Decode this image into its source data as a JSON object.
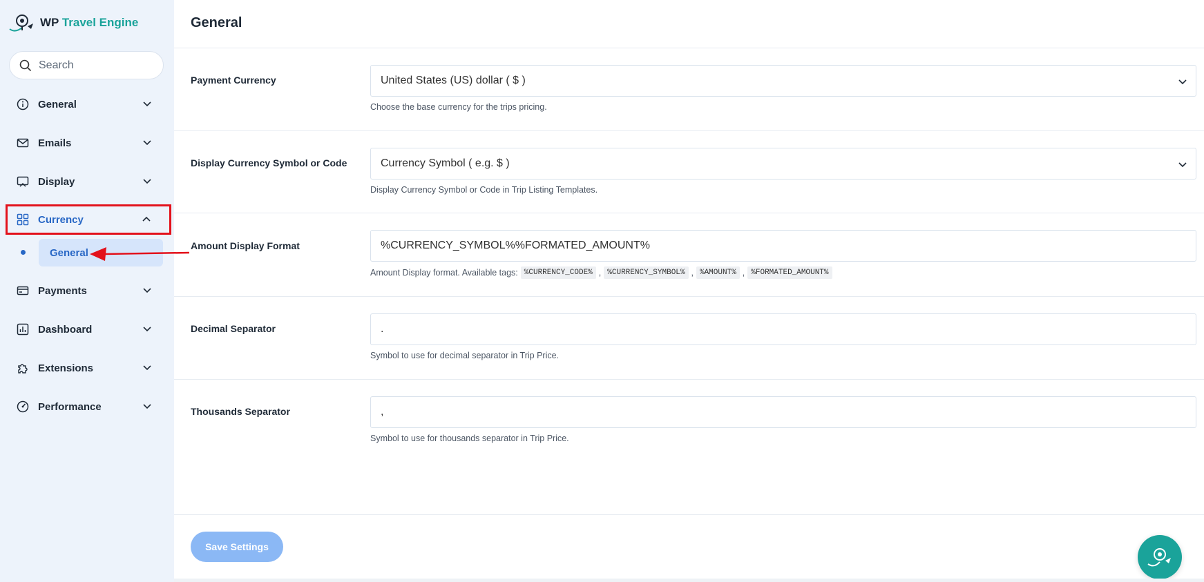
{
  "brand": {
    "prefix": "WP",
    "name": "Travel Engine",
    "accent_color": "#1aa39a"
  },
  "search": {
    "placeholder": "Search"
  },
  "sidebar": {
    "items": [
      {
        "label": "General",
        "icon": "info-icon",
        "expanded": false
      },
      {
        "label": "Emails",
        "icon": "mail-icon",
        "expanded": false
      },
      {
        "label": "Display",
        "icon": "display-icon",
        "expanded": false
      },
      {
        "label": "Currency",
        "icon": "grid-icon",
        "expanded": true,
        "active": true
      },
      {
        "label": "Payments",
        "icon": "card-icon",
        "expanded": false
      },
      {
        "label": "Dashboard",
        "icon": "chart-icon",
        "expanded": false
      },
      {
        "label": "Extensions",
        "icon": "puzzle-icon",
        "expanded": false
      },
      {
        "label": "Performance",
        "icon": "gauge-icon",
        "expanded": false
      }
    ],
    "sub_items": [
      {
        "label": "General",
        "active": true
      }
    ]
  },
  "main": {
    "title": "General",
    "fields": [
      {
        "label": "Payment Currency",
        "type": "select",
        "value": "United States (US) dollar ( $ )",
        "help": "Choose the base currency for the trips pricing."
      },
      {
        "label": "Display Currency Symbol or Code",
        "type": "select",
        "value": "Currency Symbol ( e.g. $ )",
        "help": "Display Currency Symbol or Code in Trip Listing Templates."
      },
      {
        "label": "Amount Display Format",
        "type": "text",
        "value": "%CURRENCY_SYMBOL%%FORMATED_AMOUNT%",
        "help": "Amount Display format. Available tags:",
        "tags": [
          "%CURRENCY_CODE%",
          "%CURRENCY_SYMBOL%",
          "%AMOUNT%",
          "%FORMATED_AMOUNT%"
        ]
      },
      {
        "label": "Decimal Separator",
        "type": "text",
        "value": ".",
        "help": "Symbol to use for decimal separator in Trip Price."
      },
      {
        "label": "Thousands Separator",
        "type": "text",
        "value": ",",
        "help": "Symbol to use for thousands separator in Trip Price."
      }
    ],
    "save_label": "Save Settings"
  },
  "colors": {
    "active_nav": "#2867c5",
    "highlight_border": "#e3111b",
    "save_button": "#8bb8f5"
  }
}
